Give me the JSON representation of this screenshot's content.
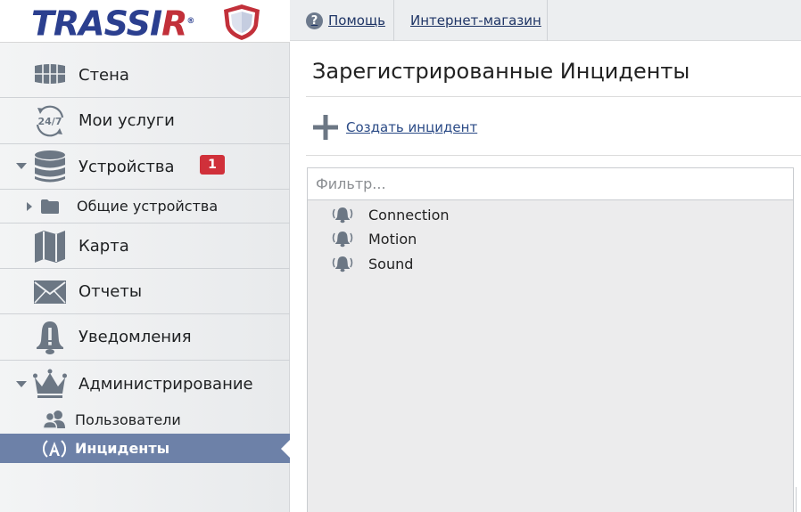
{
  "brand": {
    "logo_text_main": "TRASSI",
    "logo_text_r": "R",
    "logo_reg": "®"
  },
  "topbar": {
    "help_icon_glyph": "?",
    "help_label": "Помощь",
    "shop_label": "Интернет-магазин"
  },
  "sidebar": {
    "items": [
      {
        "label": "Стена",
        "icon": "video-wall-icon"
      },
      {
        "label": "Мои услуги",
        "icon": "24-7-icon"
      },
      {
        "label": "Устройства",
        "icon": "database-icon",
        "badge": "1"
      },
      {
        "label": "Общие устройства",
        "icon": "folder-icon"
      },
      {
        "label": "Карта",
        "icon": "map-icon"
      },
      {
        "label": "Отчеты",
        "icon": "envelope-icon"
      },
      {
        "label": "Уведомления",
        "icon": "alert-icon"
      },
      {
        "label": "Администрирование",
        "icon": "crown-icon"
      },
      {
        "label": "Пользователи",
        "icon": "users-icon"
      },
      {
        "label": "Инциденты",
        "icon": "incident-icon",
        "active": true
      }
    ]
  },
  "main": {
    "title": "Зарегистрированные Инциденты",
    "create_label": "Создать инцидент",
    "filter_placeholder": "Фильтр...",
    "incidents": [
      {
        "label": "Connection",
        "icon": "bell-icon"
      },
      {
        "label": "Motion",
        "icon": "bell-icon"
      },
      {
        "label": "Sound",
        "icon": "bell-icon"
      }
    ]
  },
  "colors": {
    "brand_blue": "#2b3f8f",
    "brand_red": "#c2303a",
    "active_item": "#6d81a8",
    "badge": "#d0303a",
    "icon_gray": "#6c7784"
  }
}
